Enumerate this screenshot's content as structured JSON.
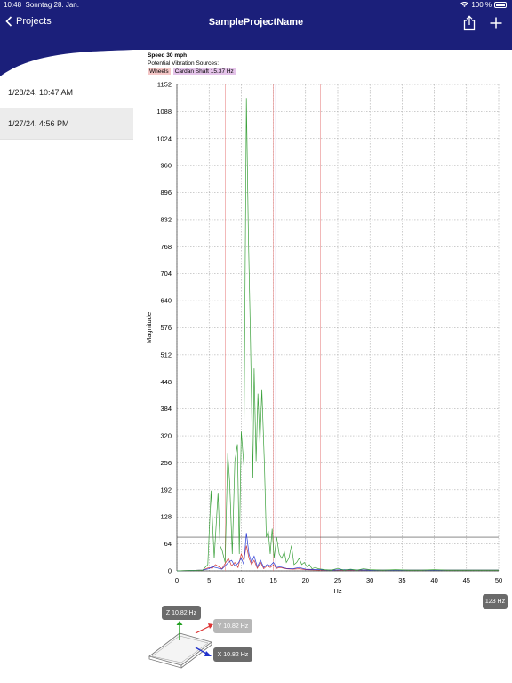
{
  "status_bar": {
    "time": "10:48",
    "date": "Sonntag 28. Jan.",
    "battery": "100 %"
  },
  "nav": {
    "back_label": "Projects",
    "title": "SampleProjectName"
  },
  "sidebar": {
    "items": [
      {
        "label": "1/28/24, 10:47 AM",
        "selected": false
      },
      {
        "label": "1/27/24, 4:56 PM",
        "selected": true
      }
    ]
  },
  "chart_header": {
    "speed": "Speed 30 mph",
    "sources_label": "Potential Vibration Sources:",
    "wheels": "Wheels",
    "cardan": "Cardan Shaft 15.37 Hz"
  },
  "chart_data": {
    "type": "line",
    "xlabel": "Hz",
    "ylabel": "Magnitude",
    "xlim": [
      0,
      50
    ],
    "ylim": [
      0,
      1152
    ],
    "x_ticks": [
      0,
      5,
      10,
      15,
      20,
      25,
      30,
      35,
      40,
      45,
      50
    ],
    "y_ticks": [
      0,
      64,
      128,
      192,
      256,
      320,
      384,
      448,
      512,
      576,
      640,
      704,
      768,
      832,
      896,
      960,
      1024,
      1088,
      1152
    ],
    "grid": true,
    "reference_lines": {
      "wheels_hz": [
        7.5,
        15.0,
        22.3
      ],
      "cardan_hz": [
        15.37
      ],
      "threshold_magnitude": 80
    },
    "series": [
      {
        "color": "#3aa03a",
        "x": [
          0,
          4,
          4.8,
          5.3,
          5.8,
          6.4,
          6.7,
          7.0,
          7.5,
          7.9,
          8.2,
          8.6,
          9.0,
          9.4,
          9.7,
          10.0,
          10.4,
          10.8,
          11.1,
          11.4,
          11.8,
          12.0,
          12.3,
          12.6,
          12.9,
          13.2,
          13.6,
          13.9,
          14.2,
          14.5,
          14.8,
          15.1,
          15.5,
          15.9,
          16.3,
          16.7,
          17.0,
          17.4,
          17.8,
          18.2,
          18.6,
          19.0,
          19.4,
          19.8,
          20.2,
          20.6,
          21.0,
          21.5,
          22.0,
          22.5,
          23,
          24,
          25,
          26,
          27,
          28,
          29,
          30,
          32,
          34,
          36,
          38,
          40,
          42,
          44,
          46,
          48,
          50
        ],
        "y": [
          0,
          2,
          15,
          190,
          30,
          185,
          60,
          50,
          20,
          280,
          210,
          40,
          260,
          300,
          40,
          330,
          250,
          1120,
          800,
          580,
          220,
          480,
          260,
          420,
          300,
          430,
          250,
          80,
          95,
          40,
          100,
          30,
          80,
          40,
          30,
          45,
          20,
          30,
          60,
          15,
          20,
          30,
          15,
          20,
          10,
          15,
          5,
          8,
          5,
          4,
          3,
          2,
          6,
          2,
          4,
          2,
          5,
          3,
          2,
          3,
          2,
          2,
          3,
          2,
          2,
          2,
          2,
          2
        ]
      },
      {
        "color": "#2b3bd6",
        "x": [
          0,
          4,
          5,
          5.5,
          6,
          7,
          8,
          8.5,
          9,
          9.5,
          10,
          10.4,
          10.8,
          11.2,
          11.6,
          12,
          12.5,
          13,
          13.5,
          14,
          14.5,
          15,
          15.5,
          16,
          17,
          18,
          19,
          20,
          22,
          24,
          26,
          30,
          35,
          40,
          45,
          50
        ],
        "y": [
          0,
          2,
          5,
          10,
          8,
          4,
          20,
          25,
          12,
          18,
          30,
          15,
          90,
          40,
          20,
          35,
          10,
          25,
          8,
          15,
          12,
          20,
          8,
          10,
          6,
          5,
          8,
          4,
          3,
          2,
          3,
          2,
          2,
          2,
          2,
          2
        ]
      },
      {
        "color": "#d33a3a",
        "x": [
          0,
          4,
          5,
          5.5,
          6,
          7,
          8,
          8.5,
          9,
          9.5,
          10,
          10.4,
          10.8,
          11.2,
          11.6,
          12,
          12.5,
          13,
          13.5,
          14,
          14.5,
          15,
          15.5,
          16,
          17,
          18,
          19,
          20,
          22,
          24,
          26,
          30,
          35,
          40,
          45,
          50
        ],
        "y": [
          0,
          2,
          8,
          6,
          15,
          5,
          30,
          12,
          20,
          8,
          40,
          25,
          60,
          30,
          15,
          25,
          6,
          20,
          5,
          12,
          8,
          14,
          6,
          8,
          5,
          4,
          5,
          3,
          2,
          2,
          2,
          2,
          2,
          2,
          2,
          2
        ]
      }
    ]
  },
  "peaks": {
    "z": "Z 10.82 Hz",
    "y": "Y 10.82 Hz",
    "x": "X 10.82 Hz"
  },
  "controls": {
    "freq_button": "123 Hz"
  },
  "colors": {
    "nav_background": "#1b1f7a",
    "sidebar_selected": "#ececec",
    "wheels_line": "#e88a8a",
    "cardan_line": "#b88ad0",
    "threshold_line": "#444444"
  }
}
